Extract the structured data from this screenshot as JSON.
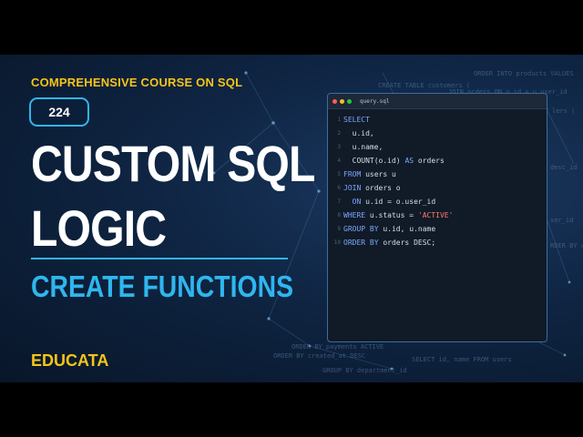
{
  "thumbnail": {
    "kicker": "COMPREHENSIVE COURSE ON SQL",
    "episode": "224",
    "title_line1": "CUSTOM SQL",
    "title_line2": "LOGIC",
    "subtitle": "CREATE FUNCTIONS",
    "brand": "EDUCATA"
  },
  "editor": {
    "filename": "query.sql",
    "lines": [
      {
        "n": "1",
        "parts": [
          {
            "t": "SELECT",
            "k": "kw"
          }
        ]
      },
      {
        "n": "2",
        "parts": [
          {
            "t": "  u.id,",
            "k": "tx"
          }
        ]
      },
      {
        "n": "3",
        "parts": [
          {
            "t": "  u.name,",
            "k": "tx"
          }
        ]
      },
      {
        "n": "4",
        "parts": [
          {
            "t": "  COUNT(o.id) ",
            "k": "tx"
          },
          {
            "t": "AS",
            "k": "kw"
          },
          {
            "t": " orders",
            "k": "tx"
          }
        ]
      },
      {
        "n": "5",
        "parts": [
          {
            "t": "FROM",
            "k": "kw"
          },
          {
            "t": " users u",
            "k": "tx"
          }
        ]
      },
      {
        "n": "6",
        "parts": [
          {
            "t": "JOIN",
            "k": "kw"
          },
          {
            "t": " orders o",
            "k": "tx"
          }
        ]
      },
      {
        "n": "7",
        "parts": [
          {
            "t": "  ON",
            "k": "kw"
          },
          {
            "t": " u.id = o.user_id",
            "k": "tx"
          }
        ]
      },
      {
        "n": "8",
        "parts": [
          {
            "t": "WHERE",
            "k": "kw"
          },
          {
            "t": " u.status = ",
            "k": "tx"
          },
          {
            "t": "'ACTIVE'",
            "k": "str"
          }
        ]
      },
      {
        "n": "9",
        "parts": [
          {
            "t": "GROUP BY",
            "k": "kw"
          },
          {
            "t": " u.id, u.name",
            "k": "tx"
          }
        ]
      },
      {
        "n": "10",
        "parts": [
          {
            "t": "ORDER BY",
            "k": "kw"
          },
          {
            "t": " orders DESC;",
            "k": "tx"
          }
        ]
      }
    ]
  },
  "background_code": [
    "ORDER INTO products VALUES",
    "CREATE TABLE customers (",
    "JOIN orders ON u.id = u.user_id",
    "lers (",
    "desc_id",
    "ser_id",
    "RDER BY users",
    "ORDER BY payments ACTIVE",
    "ORDER BY created_at DESC",
    "SELECT id, name FROM users",
    "GROUP BY department_id"
  ],
  "colors": {
    "accent_yellow": "#f5c518",
    "accent_blue": "#2fb6ee",
    "keyword": "#7aa8ff",
    "string": "#ff7b72"
  }
}
